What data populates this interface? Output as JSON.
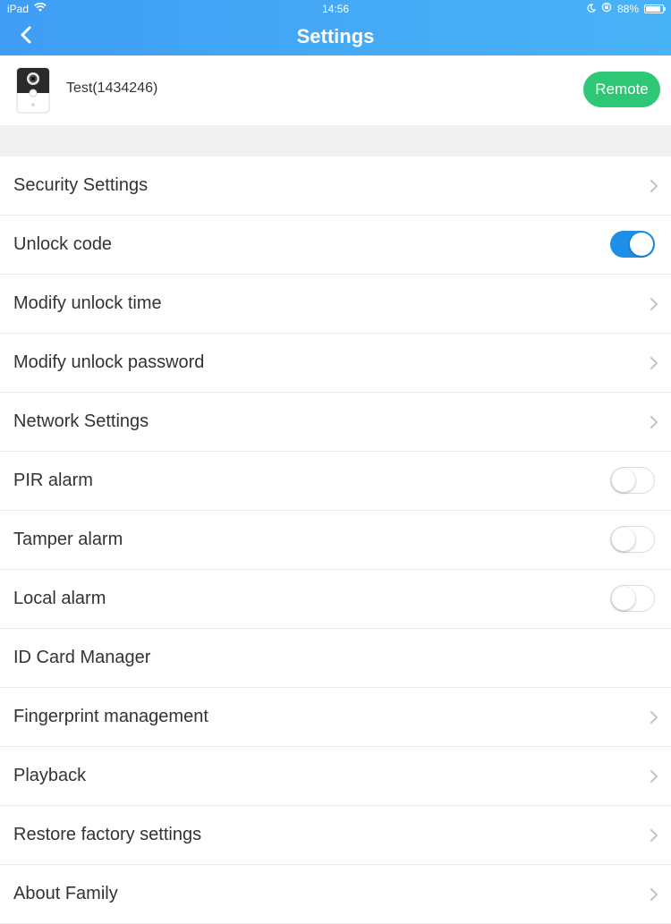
{
  "status_bar": {
    "carrier": "iPad",
    "wifi_icon": "wifi-icon",
    "time": "14:56",
    "moon_icon": "moon-icon",
    "lock_icon": "rotation-lock-icon",
    "battery": "88%",
    "battery_level": 0.88
  },
  "nav": {
    "back_icon": "chevron-left-icon",
    "title": "Settings"
  },
  "device": {
    "icon": "doorbell-camera-icon",
    "name": "Test(1434246)",
    "remote_label": "Remote"
  },
  "colors": {
    "header": "#45aaf5",
    "remote": "#2ec776",
    "toggle_on": "#1e8fe6"
  },
  "settings": [
    {
      "label": "Security Settings",
      "control": "chevron"
    },
    {
      "label": "Unlock code",
      "control": "toggle",
      "on": true
    },
    {
      "label": "Modify unlock time",
      "control": "chevron"
    },
    {
      "label": "Modify unlock password",
      "control": "chevron"
    },
    {
      "label": "Network Settings",
      "control": "chevron"
    },
    {
      "label": "PIR alarm",
      "control": "toggle",
      "on": false
    },
    {
      "label": "Tamper alarm",
      "control": "toggle",
      "on": false
    },
    {
      "label": "Local alarm",
      "control": "toggle",
      "on": false
    },
    {
      "label": "ID Card Manager",
      "control": "none"
    },
    {
      "label": "Fingerprint management",
      "control": "chevron"
    },
    {
      "label": "Playback",
      "control": "chevron"
    },
    {
      "label": "Restore factory settings",
      "control": "chevron"
    },
    {
      "label": "About Family",
      "control": "chevron"
    }
  ]
}
